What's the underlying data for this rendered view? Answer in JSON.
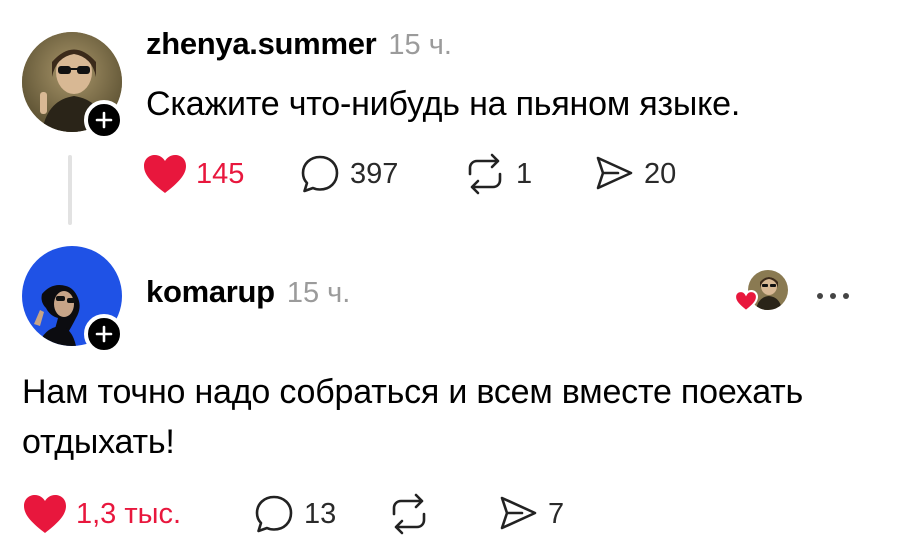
{
  "post1": {
    "username": "zhenya.summer",
    "time": "15 ч.",
    "text": "Скажите что-нибудь на пьяном языке.",
    "likes": "145",
    "replies": "397",
    "reposts": "1",
    "shares": "20",
    "liked": true
  },
  "post2": {
    "username": "komarup",
    "time": "15 ч.",
    "text_line1": "Нам точно надо собраться и всем вместе поехать",
    "text_line2": "отдыхать!",
    "likes": "1,3 тыс.",
    "replies": "13",
    "shares": "7",
    "liked": true,
    "author_liked": true
  },
  "colors": {
    "like": "#e8173d",
    "secondary_text": "#9b9b9b",
    "avatar2_bg": "#1f52e6"
  }
}
